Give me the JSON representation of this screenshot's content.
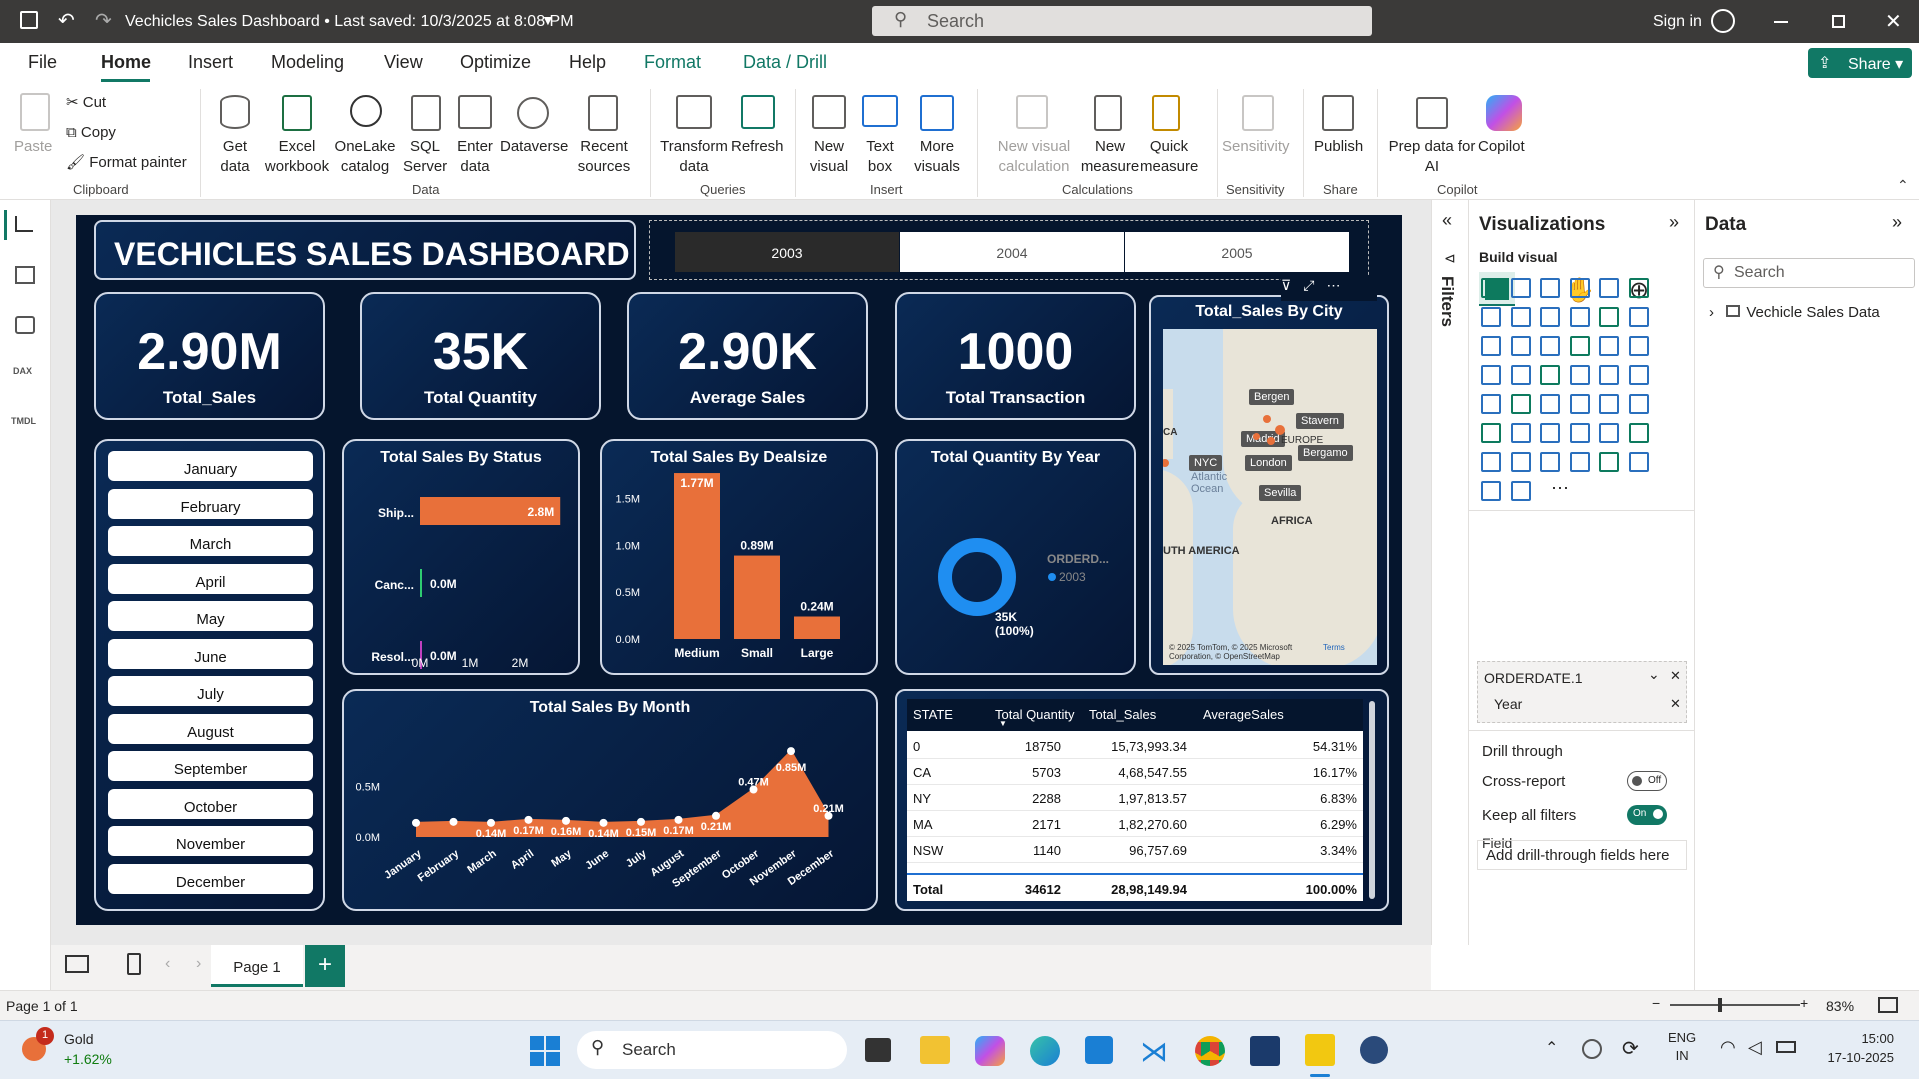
{
  "titlebar": {
    "title": "Vechicles Sales Dashboard • Last saved: 10/3/2025 at 8:08 PM",
    "search_placeholder": "Search",
    "signin": "Sign in"
  },
  "menu": {
    "items": [
      "File",
      "Home",
      "Insert",
      "Modeling",
      "View",
      "Optimize",
      "Help",
      "Format",
      "Data / Drill"
    ],
    "active": "Home",
    "share": "Share"
  },
  "ribbon": {
    "clipboard": {
      "paste": "Paste",
      "cut": "Cut",
      "copy": "Copy",
      "format_painter": "Format painter",
      "group": "Clipboard"
    },
    "data": {
      "get_data": "Get data",
      "excel": "Excel workbook",
      "onelake": "OneLake catalog",
      "sql": "SQL Server",
      "enter": "Enter data",
      "dataverse": "Dataverse",
      "recent": "Recent sources",
      "group": "Data"
    },
    "queries": {
      "transform": "Transform data",
      "refresh": "Refresh",
      "group": "Queries"
    },
    "insert": {
      "new_visual": "New visual",
      "text_box": "Text box",
      "more_visuals": "More visuals",
      "group": "Insert"
    },
    "calculations": {
      "new_visual_calc": "New visual calculation",
      "new_measure": "New measure",
      "quick_measure": "Quick measure",
      "group": "Calculations"
    },
    "sensitivity": {
      "sensitivity": "Sensitivity",
      "group": "Sensitivity"
    },
    "share": {
      "publish": "Publish",
      "group": "Share"
    },
    "copilot": {
      "prep": "Prep data for AI",
      "copilot": "Copilot",
      "group": "Copilot"
    }
  },
  "dashboard": {
    "title": "VECHICLES SALES DASHBOARD",
    "years": [
      "2003",
      "2004",
      "2005"
    ],
    "selected_year": "2003",
    "kpis": [
      {
        "value": "2.90M",
        "label": "Total_Sales"
      },
      {
        "value": "35K",
        "label": "Total Quantity"
      },
      {
        "value": "2.90K",
        "label": "Average Sales"
      },
      {
        "value": "1000",
        "label": "Total Transaction"
      }
    ],
    "months": [
      "January",
      "February",
      "March",
      "April",
      "May",
      "June",
      "July",
      "August",
      "September",
      "October",
      "November",
      "December"
    ],
    "map": {
      "title": "Total_Sales By City",
      "labels": [
        "Bergen",
        "Stavern",
        "Madrid",
        "EUROPE",
        "Bergamo",
        "NYC",
        "London",
        "Sevilla",
        "Atlantic",
        "Ocean",
        "AFRICA",
        "UTH AMERICA",
        "CA"
      ],
      "attribution": "© 2025 TomTom, © 2025 Microsoft Corporation, © OpenStreetMap",
      "terms": "Terms"
    },
    "table": {
      "headers": [
        "STATE",
        "Total Quantity",
        "Total_Sales",
        "AverageSales"
      ],
      "rows": [
        [
          "0",
          "18750",
          "15,73,993.34",
          "54.31%"
        ],
        [
          "CA",
          "5703",
          "4,68,547.55",
          "16.17%"
        ],
        [
          "NY",
          "2288",
          "1,97,813.57",
          "6.83%"
        ],
        [
          "MA",
          "2171",
          "1,82,270.60",
          "6.29%"
        ],
        [
          "NSW",
          "1140",
          "96,757.69",
          "3.34%"
        ]
      ],
      "total": [
        "Total",
        "34612",
        "28,98,149.94",
        "100.00%"
      ]
    }
  },
  "chart_data": [
    {
      "type": "bar",
      "title": "Total Sales By Status",
      "categories": [
        "Ship...",
        "Canc...",
        "Resol..."
      ],
      "values": [
        2.8,
        0.0,
        0.0
      ],
      "value_labels": [
        "2.8M",
        "0.0M",
        "0.0M"
      ],
      "orientation": "horizontal",
      "xticks": [
        "0M",
        "1M",
        "2M"
      ],
      "color": "#e8703a"
    },
    {
      "type": "bar",
      "title": "Total Sales By Dealsize",
      "categories": [
        "Medium",
        "Small",
        "Large"
      ],
      "values": [
        1.77,
        0.89,
        0.24
      ],
      "value_labels": [
        "1.77M",
        "0.89M",
        "0.24M"
      ],
      "yticks": [
        "0.0M",
        "0.5M",
        "1.0M",
        "1.5M"
      ],
      "ylim": [
        0,
        1.6
      ],
      "color": "#e8703a"
    },
    {
      "type": "pie",
      "title": "Total Quantity By Year",
      "legend_title": "ORDERD...",
      "series": [
        {
          "name": "2003",
          "value": 35
        }
      ],
      "data_label": "35K",
      "data_percent": "(100%)",
      "color": "#1f8ef1"
    },
    {
      "type": "area",
      "title": "Total Sales By Month",
      "categories": [
        "January",
        "February",
        "March",
        "April",
        "May",
        "June",
        "July",
        "August",
        "September",
        "October",
        "November",
        "December"
      ],
      "values": [
        0.14,
        0.15,
        0.14,
        0.17,
        0.16,
        0.14,
        0.15,
        0.17,
        0.21,
        0.47,
        0.85,
        0.21
      ],
      "value_labels": [
        "",
        "",
        "0.14M",
        "0.17M",
        "0.16M",
        "0.14M",
        "0.15M",
        "0.17M",
        "0.21M",
        "0.47M",
        "0.85M",
        "0.21M"
      ],
      "yticks": [
        "0.0M",
        "0.5M"
      ],
      "ylim": [
        0,
        0.95
      ],
      "color": "#e8703a"
    }
  ],
  "filters": {
    "label": "Filters"
  },
  "visualizations": {
    "title": "Visualizations",
    "build": "Build visual",
    "field_label": "Field",
    "field_name": "ORDERDATE.1",
    "field_sub": "Year",
    "drill": "Drill through",
    "cross_report": "Cross-report",
    "cross_state": "Off",
    "keep_filters": "Keep all filters",
    "keep_state": "On",
    "drop_hint": "Add drill-through fields here"
  },
  "data_pane": {
    "title": "Data",
    "search_placeholder": "Search",
    "table": "Vechicle Sales Data"
  },
  "pages": {
    "tab": "Page 1",
    "status": "Page 1 of 1",
    "zoom": "83%"
  },
  "taskbar": {
    "gold_label": "Gold",
    "gold_change": "+1.62%",
    "gold_badge": "1",
    "search": "Search",
    "lang1": "ENG",
    "lang2": "IN",
    "time": "15:00",
    "date": "17-10-2025"
  }
}
